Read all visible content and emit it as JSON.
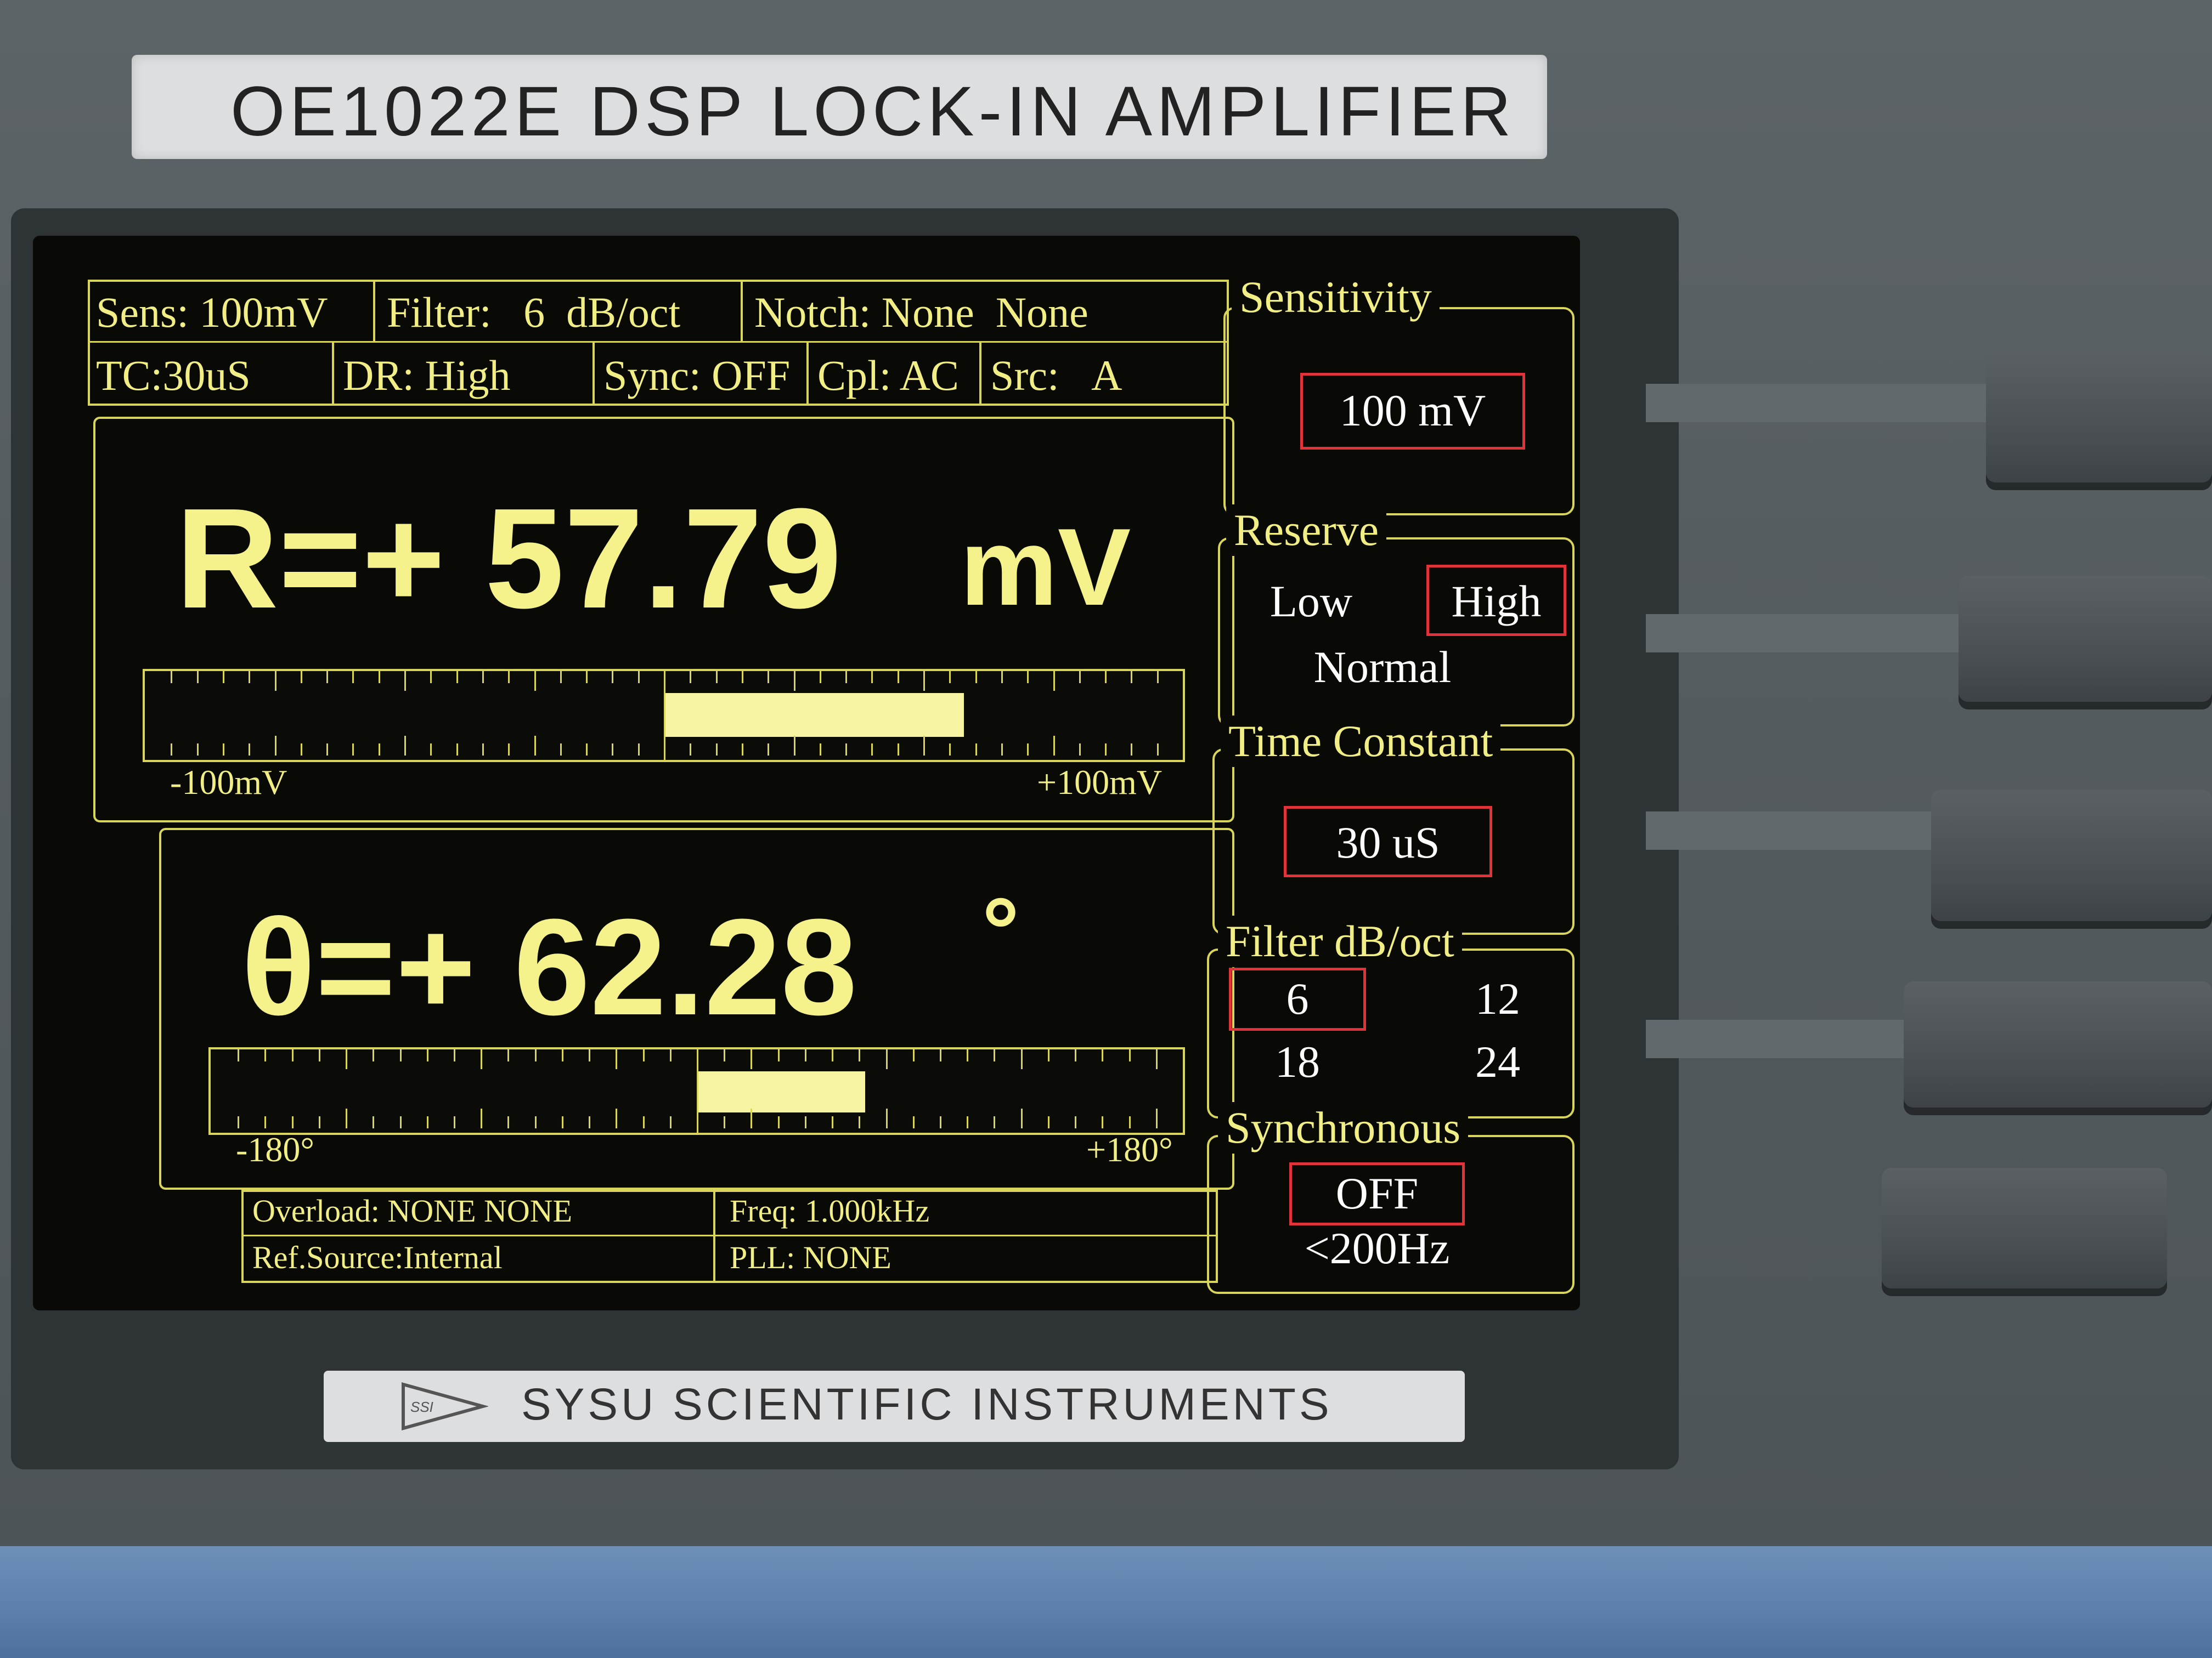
{
  "device": {
    "model_title": "OE1022E DSP LOCK-IN AMPLIFIER",
    "brand": "SYSU SCIENTIFIC INSTRUMENTS",
    "logo_text": "SSI"
  },
  "status_bar": {
    "row1": [
      {
        "label": "Sens:",
        "value": "100mV"
      },
      {
        "label": "Filter:",
        "value": "6  dB/oct"
      },
      {
        "label": "Notch:",
        "value": "None  None"
      }
    ],
    "row2": [
      {
        "label": "TC:",
        "value": "30uS"
      },
      {
        "label": "DR:",
        "value": "High"
      },
      {
        "label": "Sync:",
        "value": "OFF"
      },
      {
        "label": "Cpl:",
        "value": "AC"
      },
      {
        "label": "Src:",
        "value": "A"
      }
    ]
  },
  "readout_r": {
    "text": "R=+  57.79",
    "unit": "mV",
    "value": 57.79,
    "scale_min_label": "-100mV",
    "scale_max_label": "+100mV",
    "scale_min": -100,
    "scale_max": 100
  },
  "readout_theta": {
    "text": "θ=+  62.28",
    "unit": "°",
    "value": 62.28,
    "scale_min_label": "-180°",
    "scale_max_label": "+180°",
    "scale_min": -180,
    "scale_max": 180
  },
  "bottom_status": {
    "overload": "Overload: NONE   NONE",
    "freq": "Freq: 1.000kHz",
    "ref_source": "Ref.Source:Internal",
    "pll": "PLL:  NONE"
  },
  "menu": {
    "sensitivity": {
      "title": "Sensitivity",
      "selected": "100 mV"
    },
    "reserve": {
      "title": "Reserve",
      "options": [
        "Low",
        "High",
        "Normal"
      ],
      "selected": "High"
    },
    "time_constant": {
      "title": "Time Constant",
      "selected": "30 uS"
    },
    "filter": {
      "title": "Filter dB/oct",
      "options": [
        "6",
        "12",
        "18",
        "24"
      ],
      "selected": "6"
    },
    "synchronous": {
      "title": "Synchronous",
      "options": [
        "OFF",
        "<200Hz"
      ],
      "selected": "OFF"
    }
  },
  "colors": {
    "screen_text": "#f2ee86",
    "selection_outline": "#e0343a",
    "bar_fill": "#f6f3a2"
  }
}
